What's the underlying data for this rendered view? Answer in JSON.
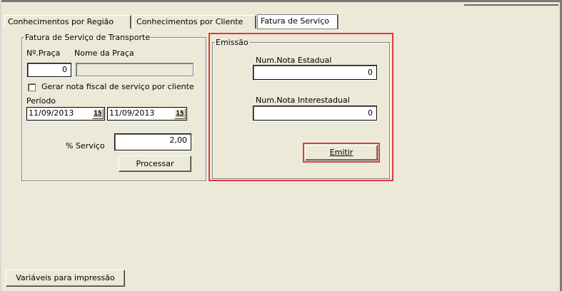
{
  "tabs": [
    {
      "label": "Conhecimentos por Região",
      "active": false
    },
    {
      "label": "Conhecimentos por Cliente",
      "active": false
    },
    {
      "label": "Fatura de Serviço",
      "active": true
    }
  ],
  "transport_group": {
    "legend": "Fatura de Serviço de Transporte",
    "praca_label": "Nº.Praça",
    "nome_praca_label": "Nome da Praça",
    "praca_value": "0",
    "nome_praca_value": "",
    "checkbox_label": "Gerar nota fiscal de serviço por cliente",
    "checkbox_checked": false,
    "periodo_label": "Período",
    "date_start": "11/09/2013",
    "date_end": "11/09/2013",
    "calendar_icon_text": "15",
    "servico_label": "% Serviço",
    "servico_value": "2,00",
    "process_button": "Processar"
  },
  "emissao_group": {
    "legend": "Emissão",
    "estadual_label": "Num.Nota Estadual",
    "estadual_value": "0",
    "interestadual_label": "Num.Nota Interestadual",
    "interestadual_value": "0",
    "emit_button": "Emitir",
    "highlight_color": "#e03a3a"
  },
  "footer": {
    "variables_button": "Variáveis para impressão"
  }
}
